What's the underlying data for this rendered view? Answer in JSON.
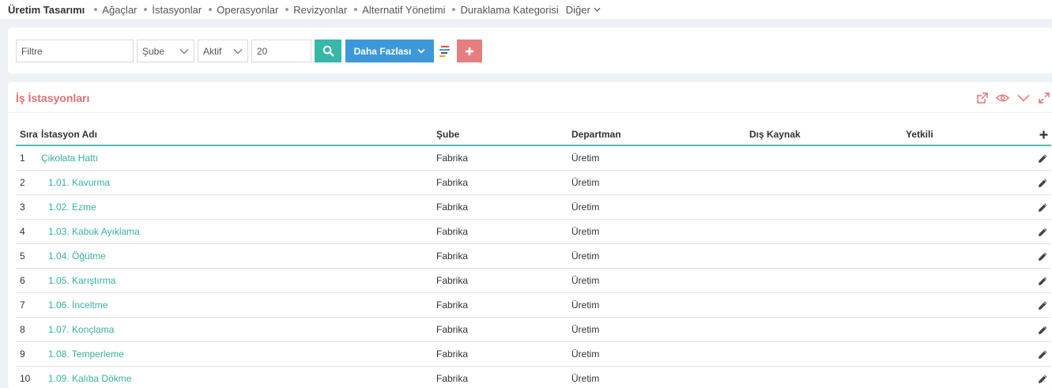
{
  "topnav": {
    "items": [
      {
        "label": "Üretim Tasarımı",
        "active": true
      },
      {
        "label": "Ağaçlar"
      },
      {
        "label": "İstasyonlar"
      },
      {
        "label": "Operasyonlar"
      },
      {
        "label": "Revizyonlar"
      },
      {
        "label": "Alternatif Yönetimi"
      },
      {
        "label": "Duraklama Kategorisi"
      },
      {
        "label": "Diğer",
        "dropdown": true
      }
    ]
  },
  "filter": {
    "filter_placeholder": "Filtre",
    "branch_select": "Şube",
    "status_select": "Aktif",
    "page_size": "20",
    "more_button": "Daha Fazlası",
    "search_icon": "search-icon",
    "columns_icon": "color-bars-icon",
    "add_icon": "plus-icon",
    "colors": {
      "search": "#36b8a8",
      "more": "#3c98d8",
      "add": "#e57f7f"
    }
  },
  "panel": {
    "title": "İş İstasyonları",
    "title_color": "#e17070",
    "tools": [
      "export-icon",
      "eye-icon",
      "chevron-down-icon",
      "expand-icon"
    ]
  },
  "table": {
    "headers": {
      "sira": "Sıra",
      "ad": "İstasyon Adı",
      "sube": "Şube",
      "departman": "Departman",
      "dis_kaynak": "Dış Kaynak",
      "yetkili": "Yetkili",
      "add": "+"
    },
    "rows": [
      {
        "sira": "1",
        "ad": "Çikolata Hattı",
        "sube": "Fabrika",
        "departman": "Üretim",
        "dis_kaynak": "",
        "yetkili": ""
      },
      {
        "sira": "2",
        "ad": "1.01. Kavurma",
        "sube": "Fabrika",
        "departman": "Üretim",
        "dis_kaynak": "",
        "yetkili": ""
      },
      {
        "sira": "3",
        "ad": "1.02. Ezme",
        "sube": "Fabrika",
        "departman": "Üretim",
        "dis_kaynak": "",
        "yetkili": ""
      },
      {
        "sira": "4",
        "ad": "1.03. Kabuk Ayıklama",
        "sube": "Fabrika",
        "departman": "Üretim",
        "dis_kaynak": "",
        "yetkili": ""
      },
      {
        "sira": "5",
        "ad": "1.04. Öğütme",
        "sube": "Fabrika",
        "departman": "Üretim",
        "dis_kaynak": "",
        "yetkili": ""
      },
      {
        "sira": "6",
        "ad": "1.05. Karıştırma",
        "sube": "Fabrika",
        "departman": "Üretim",
        "dis_kaynak": "",
        "yetkili": ""
      },
      {
        "sira": "7",
        "ad": "1.06. İnceltme",
        "sube": "Fabrika",
        "departman": "Üretim",
        "dis_kaynak": "",
        "yetkili": ""
      },
      {
        "sira": "8",
        "ad": "1.07. Konçlama",
        "sube": "Fabrika",
        "departman": "Üretim",
        "dis_kaynak": "",
        "yetkili": ""
      },
      {
        "sira": "9",
        "ad": "1.08. Temperleme",
        "sube": "Fabrika",
        "departman": "Üretim",
        "dis_kaynak": "",
        "yetkili": ""
      },
      {
        "sira": "10",
        "ad": "1.09. Kalıba Dökme",
        "sube": "Fabrika",
        "departman": "Üretim",
        "dis_kaynak": "",
        "yetkili": ""
      }
    ]
  }
}
